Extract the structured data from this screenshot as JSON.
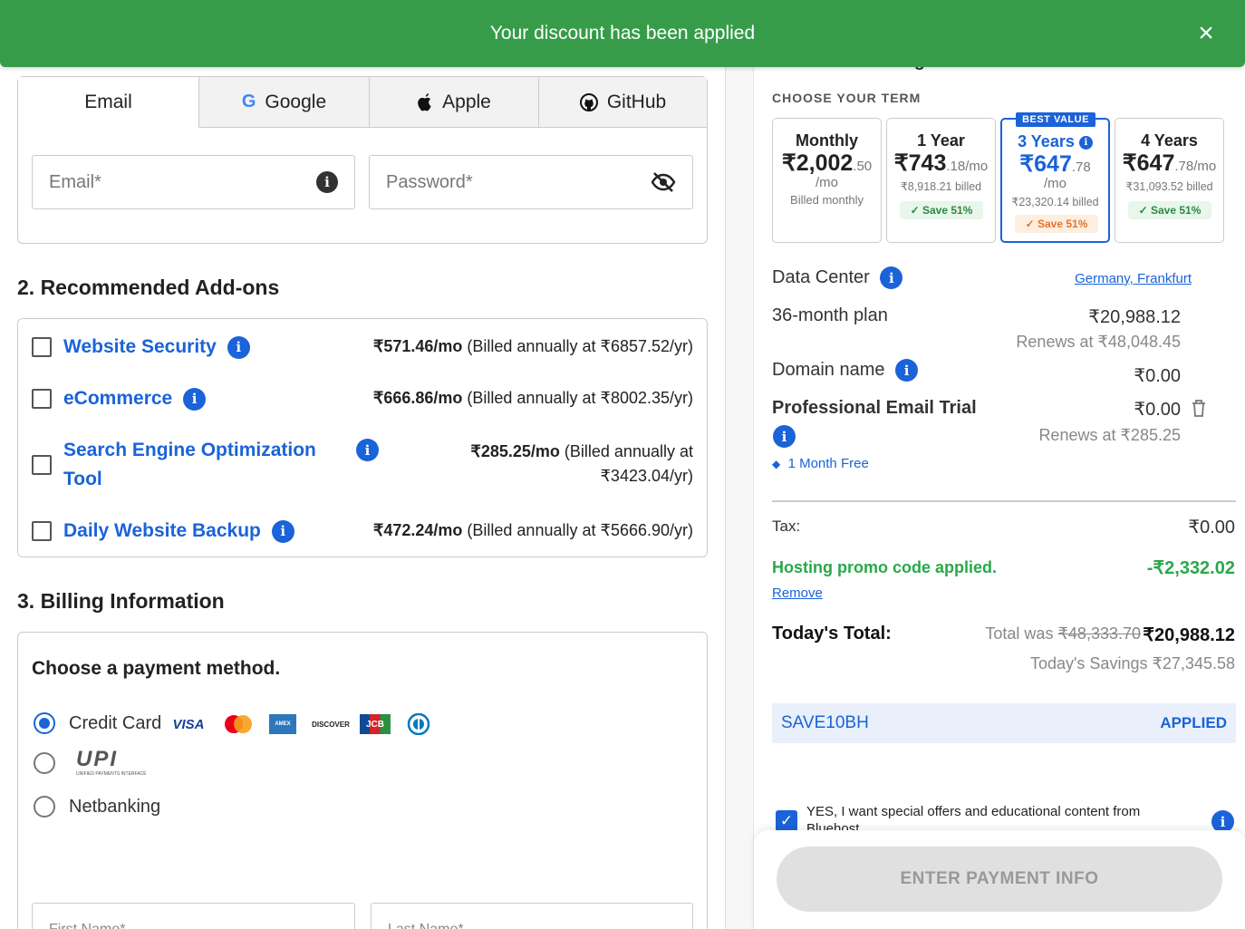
{
  "banner": {
    "message": "Your discount has been applied",
    "close_icon": "×"
  },
  "auth": {
    "tabs": [
      "Email",
      "Google",
      "Apple",
      "GitHub"
    ],
    "email_placeholder": "Email*",
    "password_placeholder": "Password*"
  },
  "addons": {
    "heading": "2. Recommended Add-ons",
    "items": [
      {
        "name": "Website Security",
        "price": "₹571.46/mo",
        "billed": "(Billed annually at ₹6857.52/yr)"
      },
      {
        "name": "eCommerce",
        "price": "₹666.86/mo",
        "billed": "(Billed annually at ₹8002.35/yr)"
      },
      {
        "name": "Search Engine Optimization Tool",
        "price": "₹285.25/mo",
        "billed": "(Billed annually at ₹3423.04/yr)"
      },
      {
        "name": "Daily Website Backup",
        "price": "₹472.24/mo",
        "billed": "(Billed annually at ₹5666.90/yr)"
      }
    ]
  },
  "billing": {
    "heading": "3. Billing Information",
    "choose": "Choose a payment method.",
    "methods": [
      "Credit Card",
      "UPI",
      "Netbanking"
    ],
    "upi_sub": "UNIFIED PAYMENTS INTERFACE",
    "cards": [
      "VISA",
      "MC",
      "AMEX",
      "DISCOVER",
      "JCB",
      "DINERS"
    ],
    "first_name": "First Name*",
    "last_name": "Last Name*"
  },
  "summary": {
    "product_title": "Business Hosting",
    "term_heading": "CHOOSE YOUR TERM",
    "terms": [
      {
        "name": "Monthly",
        "price_main": "₹2,002",
        "price_dec": ".50",
        "per": "/mo",
        "billed": "Billed monthly",
        "save": ""
      },
      {
        "name": "1 Year",
        "price_main": "₹743",
        "price_dec": ".18/mo",
        "per": "",
        "billed": "₹8,918.21 billed",
        "save": "✓ Save 51%"
      },
      {
        "name": "3 Years",
        "price_main": "₹647",
        "price_dec": ".78",
        "per": "/mo",
        "billed": "₹23,320.14 billed",
        "save": "✓ Save 51%",
        "badge": "BEST VALUE"
      },
      {
        "name": "4 Years",
        "price_main": "₹647",
        "price_dec": ".78/mo",
        "per": "",
        "billed": "₹31,093.52 billed",
        "save": "✓ Save 51%"
      }
    ],
    "data_center_label": "Data Center",
    "data_center_value": "Germany, Frankfurt",
    "plan_label": "36-month plan",
    "plan_price": "₹20,988.12",
    "plan_renews": "Renews at ₹48,048.45",
    "domain_label": "Domain name",
    "domain_price": "₹0.00",
    "email_label": "Professional Email Trial",
    "email_price": "₹0.00",
    "email_renews": "Renews at ₹285.25",
    "email_free": "1 Month Free",
    "tax_label": "Tax:",
    "tax_value": "₹0.00",
    "promo_label": "Hosting promo code applied.",
    "promo_value": "-₹2,332.02",
    "remove": "Remove",
    "total_label": "Today's Total:",
    "total_was_label": "Total was",
    "total_was_value": "₹48,333.70",
    "total_value": "₹20,988.12",
    "savings": "Today's Savings ₹27,345.58",
    "promo_code": "SAVE10BH",
    "promo_status": "APPLIED",
    "optin_text": "YES, I want special offers and educational content from",
    "optin_text2": "Bluehost",
    "cta": "ENTER PAYMENT INFO"
  },
  "colors": {
    "banner": "#379c4a",
    "accent": "#1a63d8",
    "promo_green": "#2aa84a"
  }
}
